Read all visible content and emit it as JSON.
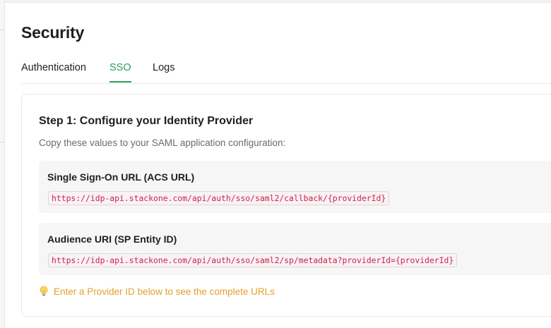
{
  "page": {
    "title": "Security"
  },
  "tabs": [
    {
      "label": "Authentication",
      "active": false
    },
    {
      "label": "SSO",
      "active": true
    },
    {
      "label": "Logs",
      "active": false
    }
  ],
  "colors": {
    "accent": "#2e9e59",
    "code_text": "#c7254e",
    "hint": "#e3a02b"
  },
  "sso": {
    "step_title": "Step 1: Configure your Identity Provider",
    "step_description": "Copy these values to your SAML application configuration:",
    "acs": {
      "label": "Single Sign-On URL (ACS URL)",
      "value": "https://idp-api.stackone.com/api/auth/sso/saml2/callback/{providerId}"
    },
    "audience": {
      "label": "Audience URI (SP Entity ID)",
      "value": "https://idp-api.stackone.com/api/auth/sso/saml2/sp/metadata?providerId={providerId}"
    },
    "hint": {
      "icon": "lightbulb-icon",
      "text": "Enter a Provider ID below to see the complete URLs"
    }
  }
}
